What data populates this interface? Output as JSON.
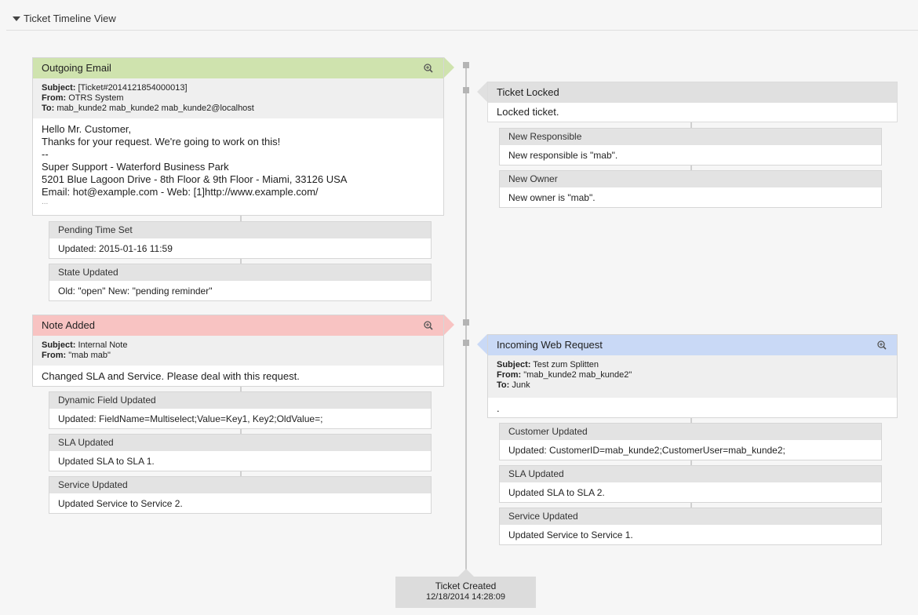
{
  "header": {
    "title": "Ticket Timeline View"
  },
  "left": {
    "outgoing": {
      "title": "Outgoing Email",
      "subject_label": "Subject:",
      "subject": " [Ticket#2014121854000013]",
      "from_label": "From:",
      "from": " OTRS System",
      "to_label": "To:",
      "to": " mab_kunde2 mab_kunde2 mab_kunde2@localhost",
      "lines": [
        "Hello Mr. Customer,",
        "Thanks for your request. We're going to work on this!",
        "--",
        "Super Support - Waterford Business Park",
        "5201 Blue Lagoon Drive - 8th Floor & 9th Floor - Miami, 33126 USA",
        "Email: hot@example.com - Web: [1]http://www.example.com/",
        "..."
      ]
    },
    "pending": {
      "title": "Pending Time Set",
      "text": "Updated: 2015-01-16 11:59"
    },
    "state": {
      "title": "State Updated",
      "text": "Old: \"open\" New: \"pending reminder\""
    },
    "note": {
      "title": "Note Added",
      "subject_label": "Subject:",
      "subject": " Internal Note",
      "from_label": "From:",
      "from": " \"mab mab\"",
      "body": "Changed SLA and Service. Please deal with this request."
    },
    "dynamic": {
      "title": "Dynamic Field Updated",
      "text": "Updated: FieldName=Multiselect;Value=Key1, Key2;OldValue=;"
    },
    "sla": {
      "title": "SLA Updated",
      "text": "Updated SLA to SLA 1."
    },
    "service": {
      "title": "Service Updated",
      "text": "Updated Service to Service 2."
    }
  },
  "right": {
    "locked": {
      "title": "Ticket Locked",
      "text": "Locked ticket."
    },
    "responsible": {
      "title": "New Responsible",
      "text": "New responsible is \"mab\"."
    },
    "owner": {
      "title": "New Owner",
      "text": "New owner is \"mab\"."
    },
    "web": {
      "title": "Incoming Web Request",
      "subject_label": "Subject:",
      "subject": " Test zum Splitten",
      "from_label": "From:",
      "from": " \"mab_kunde2 mab_kunde2\"",
      "to_label": "To:",
      "to": " Junk",
      "body": "."
    },
    "customer": {
      "title": "Customer Updated",
      "text": "Updated: CustomerID=mab_kunde2;CustomerUser=mab_kunde2;"
    },
    "sla": {
      "title": "SLA Updated",
      "text": "Updated SLA to SLA 2."
    },
    "service": {
      "title": "Service Updated",
      "text": "Updated Service to Service 1."
    }
  },
  "created": {
    "label": "Ticket Created",
    "date": "12/18/2014 14:28:09"
  },
  "colors": {
    "email": "#cfe3ae",
    "note": "#f8c3c2",
    "web": "#c9d9f6",
    "event": "#e0e0e0"
  }
}
